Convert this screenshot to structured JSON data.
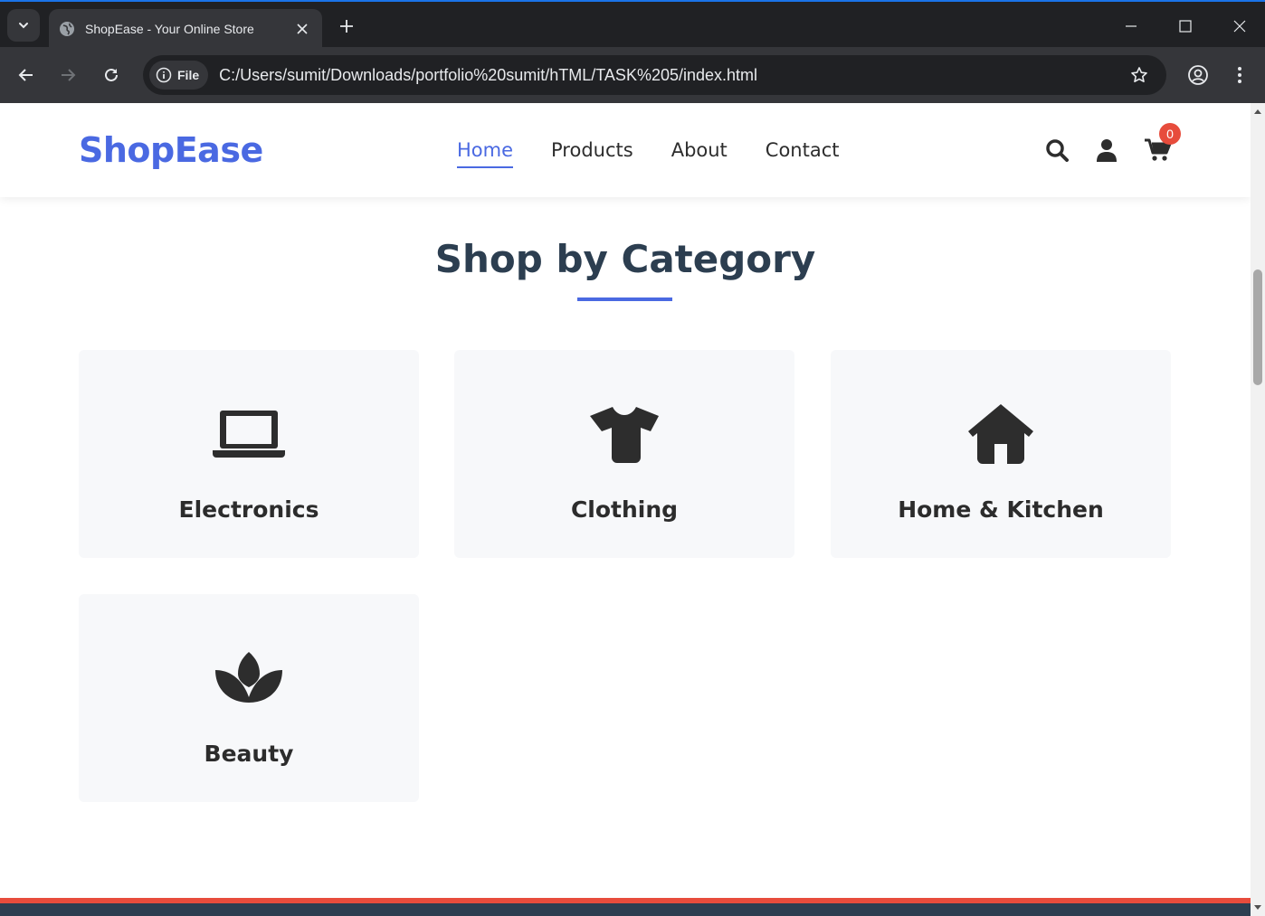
{
  "browser": {
    "tab_title": "ShopEase - Your Online Store",
    "site_chip_label": "File",
    "url": "C:/Users/sumit/Downloads/portfolio%20sumit/hTML/TASK%205/index.html",
    "accent_color": "#1a73e8"
  },
  "site": {
    "logo": "ShopEase",
    "nav": [
      {
        "label": "Home",
        "active": true
      },
      {
        "label": "Products",
        "active": false
      },
      {
        "label": "About",
        "active": false
      },
      {
        "label": "Contact",
        "active": false
      }
    ],
    "cart_count": "0",
    "brand_color": "#4a69e2",
    "badge_color": "#e74c3c"
  },
  "categories_section": {
    "title": "Shop by Category",
    "items": [
      {
        "label": "Electronics",
        "icon": "laptop-icon"
      },
      {
        "label": "Clothing",
        "icon": "tshirt-icon"
      },
      {
        "label": "Home & Kitchen",
        "icon": "home-icon"
      },
      {
        "label": "Beauty",
        "icon": "spa-icon"
      }
    ]
  }
}
